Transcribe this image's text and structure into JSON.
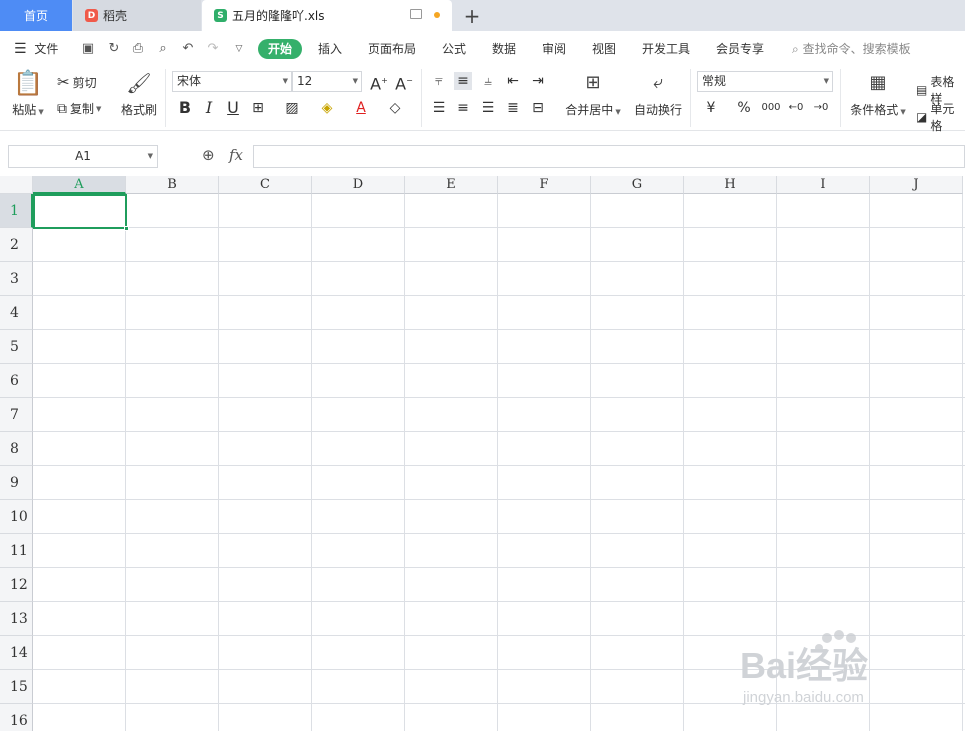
{
  "tabs": {
    "home": "首页",
    "docer": "稻壳",
    "file": "五月的隆隆吖.xls",
    "add_label": "+"
  },
  "menu": {
    "file": "文件",
    "items": [
      "开始",
      "插入",
      "页面布局",
      "公式",
      "数据",
      "审阅",
      "视图",
      "开发工具",
      "会员专享"
    ],
    "search_placeholder": "查找命令、搜索模板"
  },
  "ribbon": {
    "paste": "粘贴",
    "cut": "剪切",
    "copy": "复制",
    "format_painter": "格式刷",
    "font_name": "宋体",
    "font_size": "12",
    "merge_center": "合并居中",
    "wrap_text": "自动换行",
    "number_format": "常规",
    "currency_symbol": "¥",
    "percent_symbol": "%",
    "thousands_symbol": "000",
    "conditional_format": "条件格式",
    "table_style": "表格样",
    "cell_style": "单元格",
    "bold": "B",
    "italic": "I",
    "underline": "U",
    "increase_font": "A",
    "decrease_font": "A",
    "font_color": "A"
  },
  "formula_bar": {
    "name_box": "A1",
    "fx": "fx",
    "value": ""
  },
  "grid": {
    "columns": [
      "A",
      "B",
      "C",
      "D",
      "E",
      "F",
      "G",
      "H",
      "I",
      "J"
    ],
    "rows": [
      "1",
      "2",
      "3",
      "4",
      "5",
      "6",
      "7",
      "8",
      "9",
      "10",
      "11",
      "12",
      "13",
      "14",
      "15",
      "16"
    ],
    "active_cell": "A1"
  },
  "watermark": {
    "brand": "Bai经验",
    "url": "jingyan.baidu.com"
  },
  "colors": {
    "accent_green": "#35b06b",
    "selection": "#1f9d5c",
    "home_tab": "#4e8cf5"
  }
}
